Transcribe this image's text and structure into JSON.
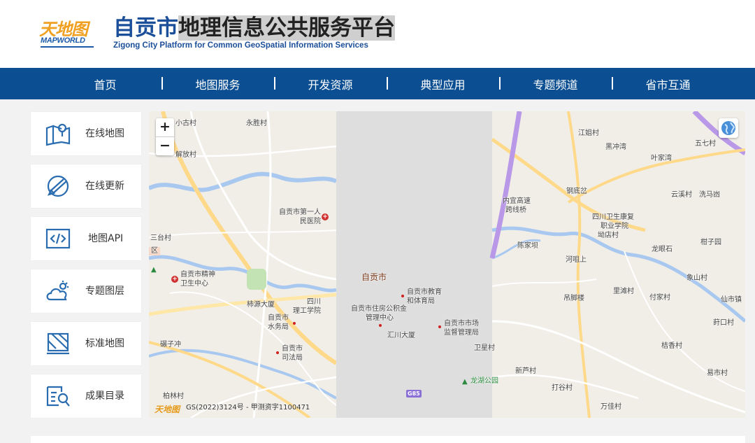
{
  "header": {
    "logo_cn": "天地图",
    "logo_en": "MAPWORLD",
    "title_prefix": "自贡市",
    "title_highlight": "地理信息公共服务平台",
    "subtitle": "Zigong City Platform for Common GeoSpatial Information Services"
  },
  "nav": {
    "items": [
      {
        "label": "首页"
      },
      {
        "label": "地图服务"
      },
      {
        "label": "开发资源"
      },
      {
        "label": "典型应用"
      },
      {
        "label": "专题频道"
      },
      {
        "label": "省市互通"
      }
    ]
  },
  "sidebar": {
    "items": [
      {
        "label": "在线地图",
        "icon": "map-pin-icon"
      },
      {
        "label": "在线更新",
        "icon": "edit-globe-icon"
      },
      {
        "label": "地图API",
        "icon": "code-icon"
      },
      {
        "label": "专题图层",
        "icon": "weather-layer-icon"
      },
      {
        "label": "标准地图",
        "icon": "standard-map-icon"
      },
      {
        "label": "成果目录",
        "icon": "catalog-search-icon"
      }
    ]
  },
  "map": {
    "zoom_in": "+",
    "zoom_out": "−",
    "logo": "天地图",
    "copyright": "GS(2022)3124号 - 甲测资字1100471",
    "city_label": "自贡市",
    "road_shield": "G85",
    "labels": {
      "xiaogu": "小古村",
      "yongsheng": "永胜村",
      "jiefang": "解放村",
      "santai": "三台村",
      "qu": "区",
      "diyi_1": "自贡市第一人",
      "diyi_2": "民医院",
      "jingshen_1": "自贡市精神",
      "jingshen_2": "卫生中心",
      "bingyuan": "柿源大厦",
      "ligong_1": "四川",
      "ligong_2": "理工学院",
      "shuiwu_1": "自贡市",
      "shuiwu_2": "水务局",
      "sifa_1": "自贡市",
      "sifa_2": "司法局",
      "yaozi": "碾子冲",
      "bailin": "柏林村",
      "jiaoyu_1": "自贡市教育",
      "jiaoyu_2": "和体育局",
      "gjj_1": "自贡市住房公积金",
      "gjj_2": "管理中心",
      "huichuan": "汇川大厦",
      "shichang_1": "自贡市市场",
      "shichang_2": "监督管理局",
      "weixing": "卫星村",
      "longhu": "龙湖公园",
      "xinlu": "新芦村",
      "dagu": "打谷村",
      "wanjia": "万佳村",
      "jiangzhi": "江姐村",
      "heichong": "黑冲湾",
      "wuqi": "五七村",
      "yejia": "叶家湾",
      "yunxi": "云溪村",
      "xima": "洗马凼",
      "gangdi": "钢底岔",
      "gaosu_1": "内宜高速",
      "gaosu_2": "跨线桥",
      "weixiao_1": "四川卫生康复",
      "weixiao_2": "职业学院",
      "weixiao_3": "坳店村",
      "chenjia": "陈家坝",
      "hekou": "河咀上",
      "longyan": "龙眼石",
      "ganzi": "柑子园",
      "xiangshan": "象山村",
      "lijiao": "吊脚楼",
      "litan": "里滩村",
      "fujia": "付家村",
      "xianshi": "仙市镇",
      "xiangkou": "莳口村",
      "jixiang": "桔香村",
      "yishi": "易市村"
    }
  }
}
